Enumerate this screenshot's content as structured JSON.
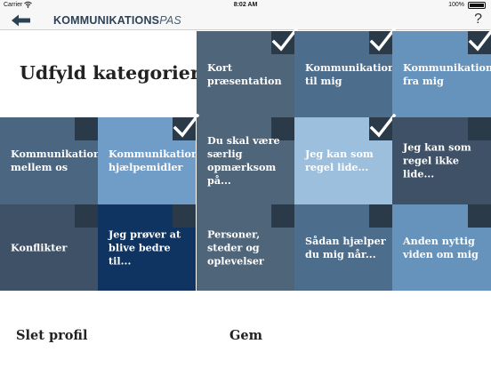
{
  "status_bar": {
    "carrier": "Carrier",
    "time": "8:02 AM",
    "battery": "100%"
  },
  "nav": {
    "brand_bold": "KOMMUNIKATIONS",
    "brand_italic": "PAS",
    "help": "?"
  },
  "page": {
    "title": "Udfyld kategorier"
  },
  "tiles": [
    {
      "label": "Kort præsentation",
      "checked": true,
      "color": "#4f6579"
    },
    {
      "label": "Kommunikation til mig",
      "checked": true,
      "color": "#4d6d8c"
    },
    {
      "label": "Kommunikation fra mig",
      "checked": true,
      "color": "#6693bc"
    },
    {
      "label": "Kommunikation mellem os",
      "checked": false,
      "color": "#4a6680"
    },
    {
      "label": "Kommunikations-hjælpemidler",
      "checked": true,
      "color": "#6f9dc8"
    },
    {
      "label": "Du skal være særlig opmærksom på...",
      "checked": false,
      "color": "#4f6579"
    },
    {
      "label": "Jeg kan som regel lide...",
      "checked": true,
      "color": "#9cbfdd"
    },
    {
      "label": "Jeg kan som regel ikke lide...",
      "checked": false,
      "color": "#3e5166"
    },
    {
      "label": "Konflikter",
      "checked": false,
      "color": "#3e5166"
    },
    {
      "label": "Jeg prøver at blive bedre til...",
      "checked": false,
      "color": "#0f3462"
    },
    {
      "label": "Personer, steder og oplevelser",
      "checked": false,
      "color": "#4f6579"
    },
    {
      "label": "Sådan hjælper du mig når...",
      "checked": false,
      "color": "#4d6d8c"
    },
    {
      "label": "Anden nyttig viden om mig",
      "checked": false,
      "color": "#6693bc"
    }
  ],
  "footer": {
    "delete_label": "Slet profil",
    "save_label": "Gem"
  }
}
